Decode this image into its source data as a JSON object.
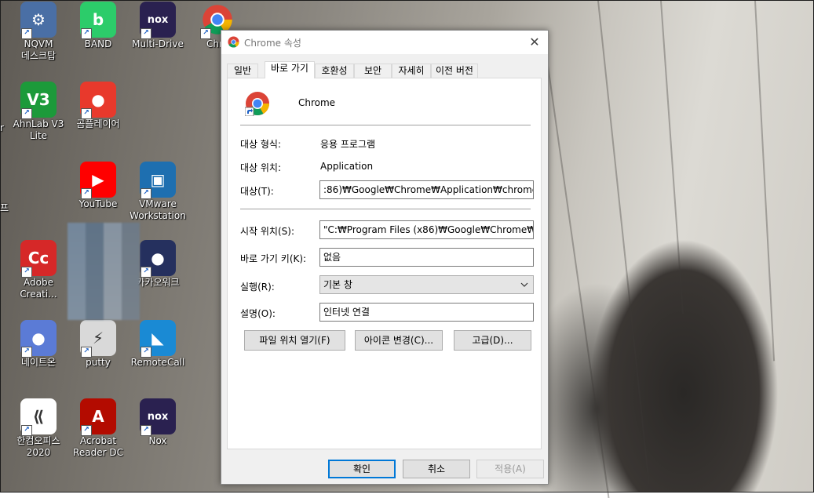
{
  "desktop": {
    "icons": [
      {
        "label": "NQVM\n데스크탑",
        "color": "#4a6fa5",
        "glyph": "⚙"
      },
      {
        "label": "BAND",
        "color": "#2ccc6a",
        "glyph": "b"
      },
      {
        "label": "Multi-Drive",
        "color": "#2a2150",
        "glyph": "nox"
      },
      {
        "label": "Chro",
        "color": "#ffffff",
        "glyph": ""
      },
      {
        "label": "AhnLab V3\nLite",
        "color": "#1c9a3a",
        "glyph": "V3"
      },
      {
        "label": "곰플레이어",
        "color": "#e8392c",
        "glyph": "●"
      },
      {
        "label": "YouTube",
        "color": "#ff0000",
        "glyph": "▶"
      },
      {
        "label": "VMware\nWorkstation",
        "color": "#1e6fb0",
        "glyph": "▣"
      },
      {
        "label": "Adobe\nCreati...",
        "color": "#d62828",
        "glyph": "Cc"
      },
      {
        "label": "카카오워크",
        "color": "#25305e",
        "glyph": "●"
      },
      {
        "label": "네이트온",
        "color": "#5b7bd6",
        "glyph": "●"
      },
      {
        "label": "putty",
        "color": "#d9d9d9",
        "glyph": "⚡"
      },
      {
        "label": "RemoteCall",
        "color": "#1a8ad4",
        "glyph": "◣"
      },
      {
        "label": "한컴오피스\n2020",
        "color": "#ffffff",
        "glyph": "⟪"
      },
      {
        "label": "Acrobat\nReader DC",
        "color": "#b30b00",
        "glyph": "A"
      },
      {
        "label": "Nox",
        "color": "#2a2150",
        "glyph": "nox"
      }
    ],
    "cut_labels": [
      "r",
      "프"
    ]
  },
  "dialog": {
    "title": "Chrome 속성",
    "close": "✕",
    "tabs": [
      "일반",
      "바로 가기",
      "호환성",
      "보안",
      "자세히",
      "이전 버전"
    ],
    "app_name": "Chrome",
    "target_type_label": "대상 형식:",
    "target_type_value": "응용 프로그램",
    "target_location_label": "대상 위치:",
    "target_location_value": "Application",
    "target_label": "대상(T):",
    "target_value": ":86)₩Google₩Chrome₩Application₩chrome.exe\"",
    "start_label": "시작 위치(S):",
    "start_value": "\"C:₩Program Files (x86)₩Google₩Chrome₩Appli",
    "hotkey_label": "바로 가기 키(K):",
    "hotkey_value": "없음",
    "run_label": "실행(R):",
    "run_value": "기본 창",
    "comment_label": "설명(O):",
    "comment_value": "인터넷 연결",
    "btn_open_location": "파일 위치 열기(F)",
    "btn_change_icon": "아이콘 변경(C)...",
    "btn_advanced": "고급(D)...",
    "btn_ok": "확인",
    "btn_cancel": "취소",
    "btn_apply": "적용(A)"
  }
}
